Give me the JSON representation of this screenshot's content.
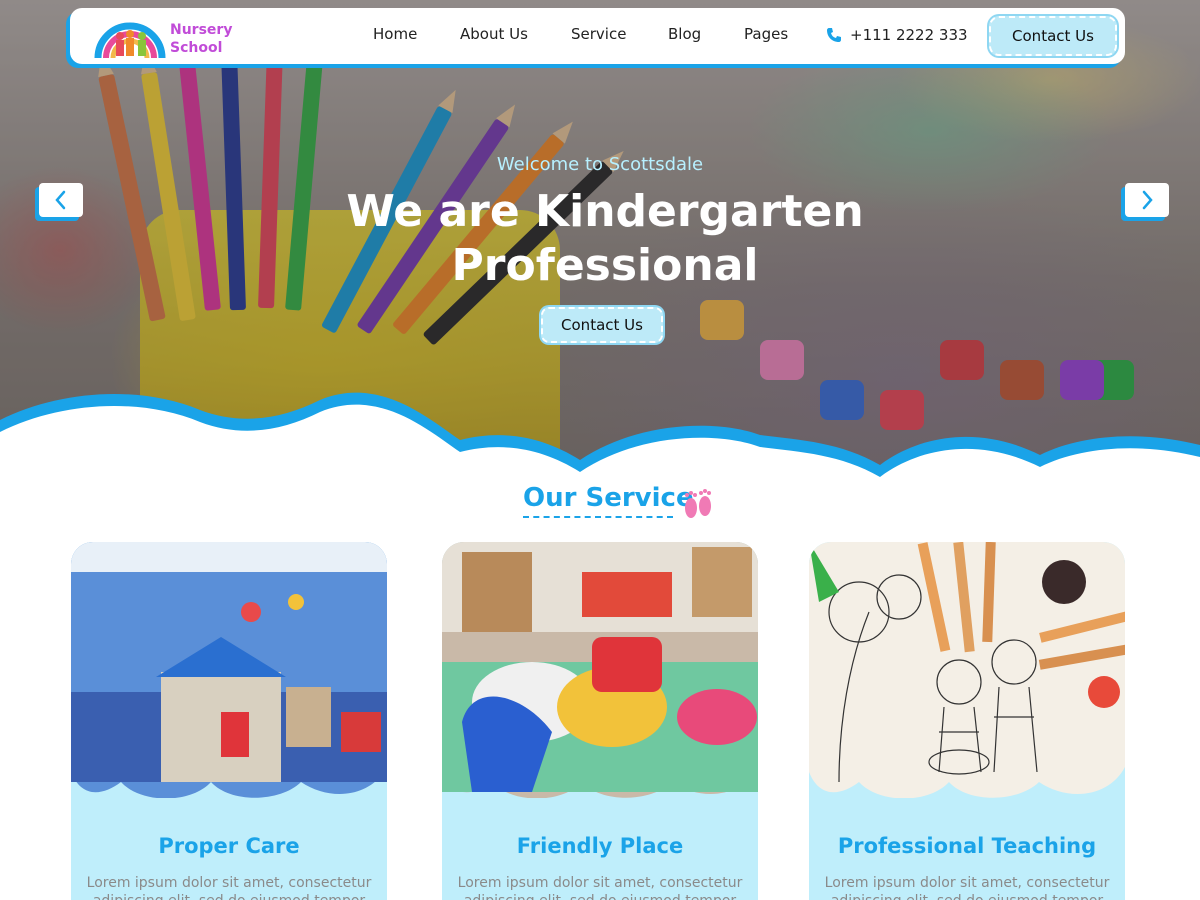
{
  "header": {
    "logo_text_line1": "Nursery",
    "logo_text_line2": "School",
    "nav": [
      "Home",
      "About Us",
      "Service",
      "Blog",
      "Pages"
    ],
    "phone": "+111 2222 333",
    "contact_label": "Contact Us"
  },
  "hero": {
    "welcome": "Welcome to Scottsdale",
    "title_line1": "We are Kindergarten",
    "title_line2": "Professional",
    "button_label": "Contact Us",
    "prev_icon": "chevron-left-icon",
    "next_icon": "chevron-right-icon"
  },
  "services": {
    "title": "Our Service",
    "cards": [
      {
        "title": "Proper Care",
        "text": "Lorem ipsum dolor sit amet, consectetur adipiscing elit, sed do eiusmod tempor"
      },
      {
        "title": "Friendly Place",
        "text": "Lorem ipsum dolor sit amet, consectetur adipiscing elit, sed do eiusmod tempor"
      },
      {
        "title": "Professional Teaching",
        "text": "Lorem ipsum dolor sit amet, consectetur adipiscing elit, sed do eiusmod tempor"
      }
    ]
  },
  "colors": {
    "accent": "#1aa3e8",
    "button_bg": "#bdeaf8",
    "card_bg": "#bfeefb",
    "logo_text": "#c14cd8",
    "welcome_text": "#b7f0ff"
  }
}
